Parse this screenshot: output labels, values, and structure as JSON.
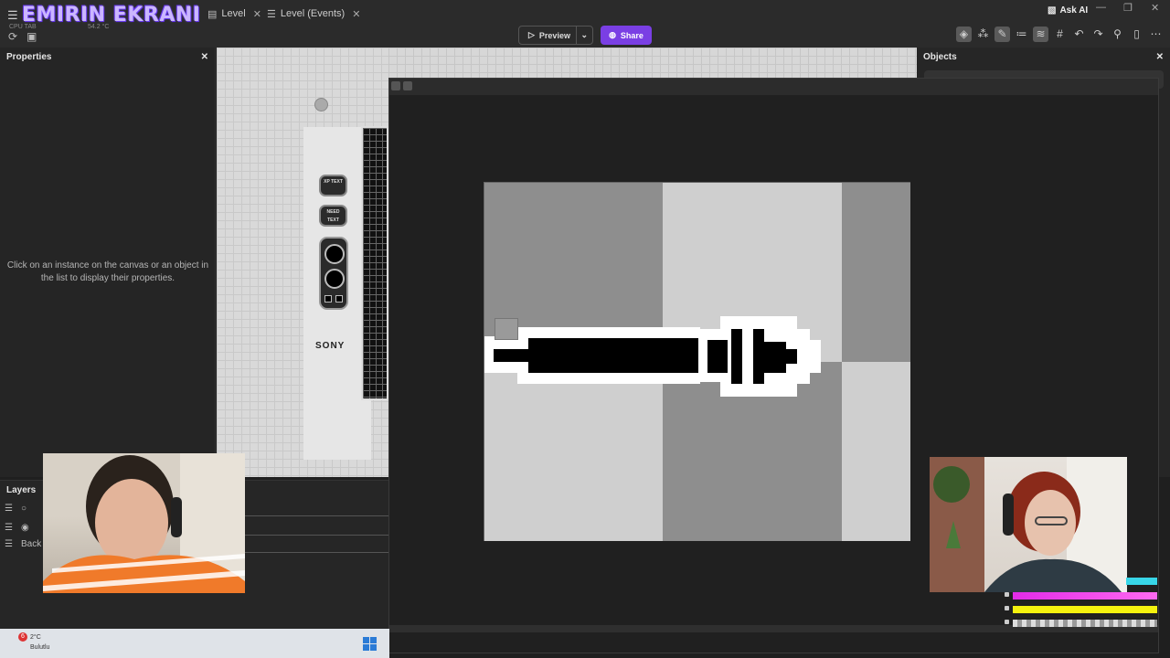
{
  "stream_overlay": {
    "title": "EMIRIN EKRANI"
  },
  "system": {
    "small_label": "CPU TAB",
    "temp": "54.2 °C"
  },
  "tabs": [
    {
      "label": "Level",
      "icon": "level-icon"
    },
    {
      "label": "Level (Events)",
      "icon": "events-icon"
    }
  ],
  "toolbar": {
    "preview_label": "Preview",
    "share_label": "Share",
    "ask_ai_label": "Ask AI",
    "accent_color": "#7a3fe4"
  },
  "properties_panel": {
    "title": "Properties",
    "hint": "Click on an instance on the canvas or an object in the list to display their properties."
  },
  "objects_panel": {
    "title": "Objects"
  },
  "layers_panel": {
    "title": "Layers",
    "items": [
      {
        "label": ""
      },
      {
        "label": ""
      },
      {
        "label": "Back"
      }
    ]
  },
  "canvas": {
    "sony_label": "SONY",
    "button_labels": [
      "XP TEXT",
      "NEED TEXT"
    ]
  },
  "taskbar": {
    "weather_badge": "6",
    "temperature": "2°C",
    "weather_text": "Bulutlu"
  }
}
